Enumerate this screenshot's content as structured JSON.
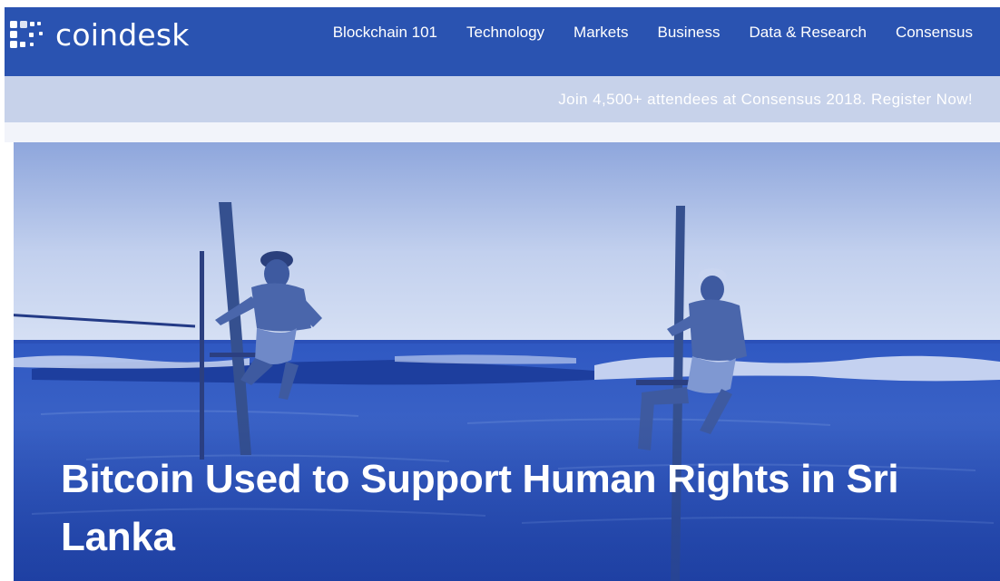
{
  "brand": {
    "name": "coindesk",
    "logo_icon": "coindesk-dots-logo-icon",
    "header_color": "#2a53b1"
  },
  "nav": {
    "items": [
      {
        "label": "Blockchain 101"
      },
      {
        "label": "Technology"
      },
      {
        "label": "Markets"
      },
      {
        "label": "Business"
      },
      {
        "label": "Data & Research"
      },
      {
        "label": "Consensus"
      }
    ]
  },
  "promo": {
    "text": "Join 4,500+ attendees at Consensus 2018. Register Now!",
    "bar_color": "#c7d2ea"
  },
  "hero": {
    "title": "Bitcoin Used to Support Human Rights in Sri Lanka",
    "image_subject": "stilt-fishermen-photo",
    "tint_color": "#2e55c0"
  }
}
